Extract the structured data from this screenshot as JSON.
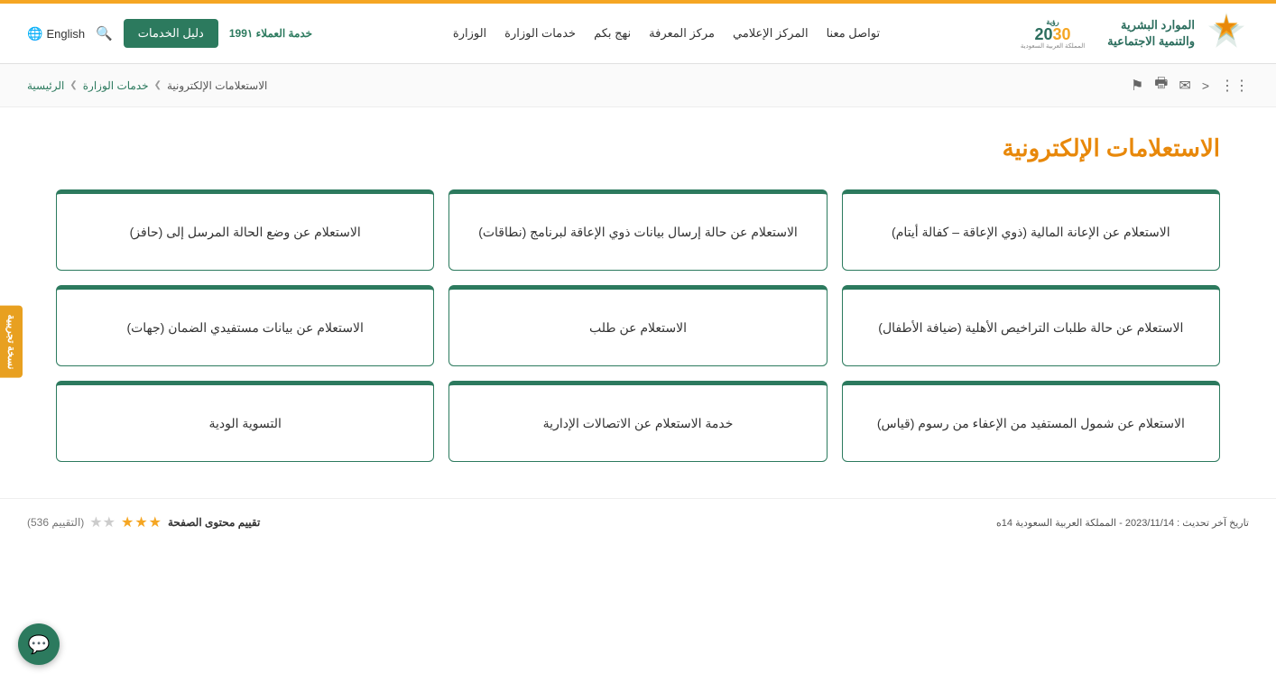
{
  "topBar": {
    "color": "#f5a623"
  },
  "header": {
    "logoText": "الموارد البشرية\nوالتنمية الاجتماعية",
    "navItems": [
      {
        "id": "ministry",
        "label": "الوزارة"
      },
      {
        "id": "ministry-services",
        "label": "خدمات الوزارة"
      },
      {
        "id": "nhj-bkm",
        "label": "نهج بكم"
      },
      {
        "id": "knowledge-center",
        "label": "مركز المعرفة"
      },
      {
        "id": "media-center",
        "label": "المركز الإعلامي"
      },
      {
        "id": "contact-us",
        "label": "تواصل معنا"
      }
    ],
    "servicesBtn": "دليل الخدمات",
    "language": "English",
    "customerService": "خدمة العملاء 199١"
  },
  "breadcrumb": {
    "items": [
      {
        "label": "الرئيسية"
      },
      {
        "label": "خدمات الوزارة"
      },
      {
        "label": "الاستعلامات الإلكترونية"
      }
    ]
  },
  "sideTab": "نسخة تجريبية",
  "pageTitle": "الاستعلامات الإلكترونية",
  "cards": [
    {
      "id": "card-1",
      "text": "الاستعلام عن الإعانة المالية (ذوي الإعاقة – كفالة أيتام)"
    },
    {
      "id": "card-2",
      "text": "الاستعلام عن حالة إرسال بيانات ذوي الإعاقة لبرنامج (نطاقات)"
    },
    {
      "id": "card-3",
      "text": "الاستعلام عن وضع الحالة المرسل إلى (حافز)"
    },
    {
      "id": "card-4",
      "text": "الاستعلام عن حالة طلبات التراخيص الأهلية (ضيافة الأطفال)"
    },
    {
      "id": "card-5",
      "text": "الاستعلام عن طلب"
    },
    {
      "id": "card-6",
      "text": "الاستعلام عن بيانات مستفيدي الضمان (جهات)"
    },
    {
      "id": "card-7",
      "text": "الاستعلام عن شمول المستفيد من الإعفاء من رسوم (قياس)"
    },
    {
      "id": "card-8",
      "text": "خدمة الاستعلام عن الاتصالات الإدارية"
    },
    {
      "id": "card-9",
      "text": "التسوية الودية"
    }
  ],
  "footer": {
    "ratingLabel": "تقييم محتوى الصفحة",
    "ratingCount": "(التقييم 536)",
    "filledStars": 3,
    "emptyStars": 2,
    "lastUpdate": "تاريخ آخر تحديث : 2023/11/14 - المملكة العربية السعودية  14ه"
  }
}
